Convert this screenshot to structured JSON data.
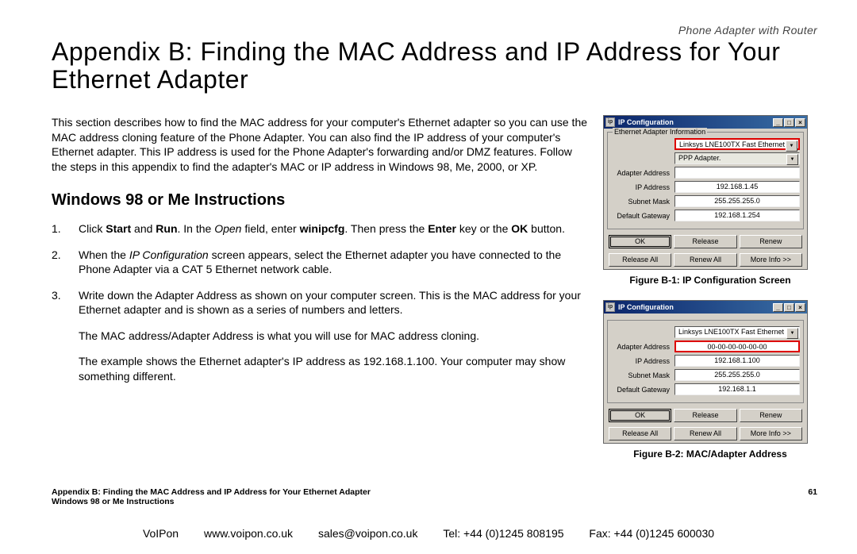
{
  "header_label": "Phone Adapter with Router",
  "title": "Appendix B: Finding the MAC Address and IP Address for Your Ethernet Adapter",
  "intro": "This section describes how to find the MAC address for your computer's Ethernet adapter so you can use the MAC address cloning feature of the Phone Adapter. You can also find the IP address of your computer's Ethernet adapter. This IP address is used for the Phone Adapter's forwarding and/or DMZ features. Follow the steps in this appendix to find the adapter's MAC or IP address in Windows 98, Me, 2000, or XP.",
  "section_head": "Windows 98 or Me Instructions",
  "steps": {
    "s1_a": "Click ",
    "s1_b": "Start",
    "s1_c": " and ",
    "s1_d": "Run",
    "s1_e": ". In the ",
    "s1_f": "Open",
    "s1_g": " field, enter ",
    "s1_h": "winipcfg",
    "s1_i": ". Then press the ",
    "s1_j": "Enter",
    "s1_k": " key or the ",
    "s1_l": "OK",
    "s1_m": " button.",
    "s2_a": "When the ",
    "s2_b": "IP Configuration",
    "s2_c": " screen appears, select the Ethernet adapter you have connected to the Phone Adapter via a CAT 5 Ethernet network cable.",
    "s3": "Write down the Adapter Address as shown on your computer screen. This is the MAC address for your Ethernet adapter and is shown as a series of numbers and letters.",
    "s3b": "The MAC address/Adapter Address is what you will use for MAC address cloning.",
    "s3c": "The example shows the Ethernet adapter's IP address as 192.168.1.100. Your computer may show something different."
  },
  "fig1": {
    "title": "IP Configuration",
    "group": "Ethernet Adapter Information",
    "dropdown1": "Linksys LNE100TX Fast Ethernet",
    "dropdown2": "PPP Adapter.",
    "rows": {
      "adapter_label": "Adapter Address",
      "adapter_val": "",
      "ip_label": "IP Address",
      "ip_val": "192.168.1.45",
      "subnet_label": "Subnet Mask",
      "subnet_val": "255.255.255.0",
      "gw_label": "Default Gateway",
      "gw_val": "192.168.1.254"
    },
    "buttons": {
      "ok": "OK",
      "release": "Release",
      "renew": "Renew",
      "release_all": "Release All",
      "renew_all": "Renew All",
      "more": "More Info >>"
    },
    "caption": "Figure B-1: IP Configuration Screen"
  },
  "fig2": {
    "title": "IP Configuration",
    "group": "",
    "dropdown1": "Linksys LNE100TX Fast Ethernet",
    "rows": {
      "adapter_label": "Adapter Address",
      "adapter_val": "00-00-00-00-00-00",
      "ip_label": "IP Address",
      "ip_val": "192.168.1.100",
      "subnet_label": "Subnet Mask",
      "subnet_val": "255.255.255.0",
      "gw_label": "Default Gateway",
      "gw_val": "192.168.1.1"
    },
    "buttons": {
      "ok": "OK",
      "release": "Release",
      "renew": "Renew",
      "release_all": "Release All",
      "renew_all": "Renew All",
      "more": "More Info >>"
    },
    "caption": "Figure B-2: MAC/Adapter Address"
  },
  "footer_meta": {
    "left1": "Appendix B: Finding the MAC Address and IP Address for Your Ethernet Adapter",
    "left2": "Windows 98 or Me Instructions",
    "page": "61"
  },
  "footer_contact": {
    "c1": "VoIPon",
    "c2": "www.voipon.co.uk",
    "c3": "sales@voipon.co.uk",
    "c4": "Tel: +44 (0)1245 808195",
    "c5": "Fax: +44 (0)1245 600030"
  }
}
